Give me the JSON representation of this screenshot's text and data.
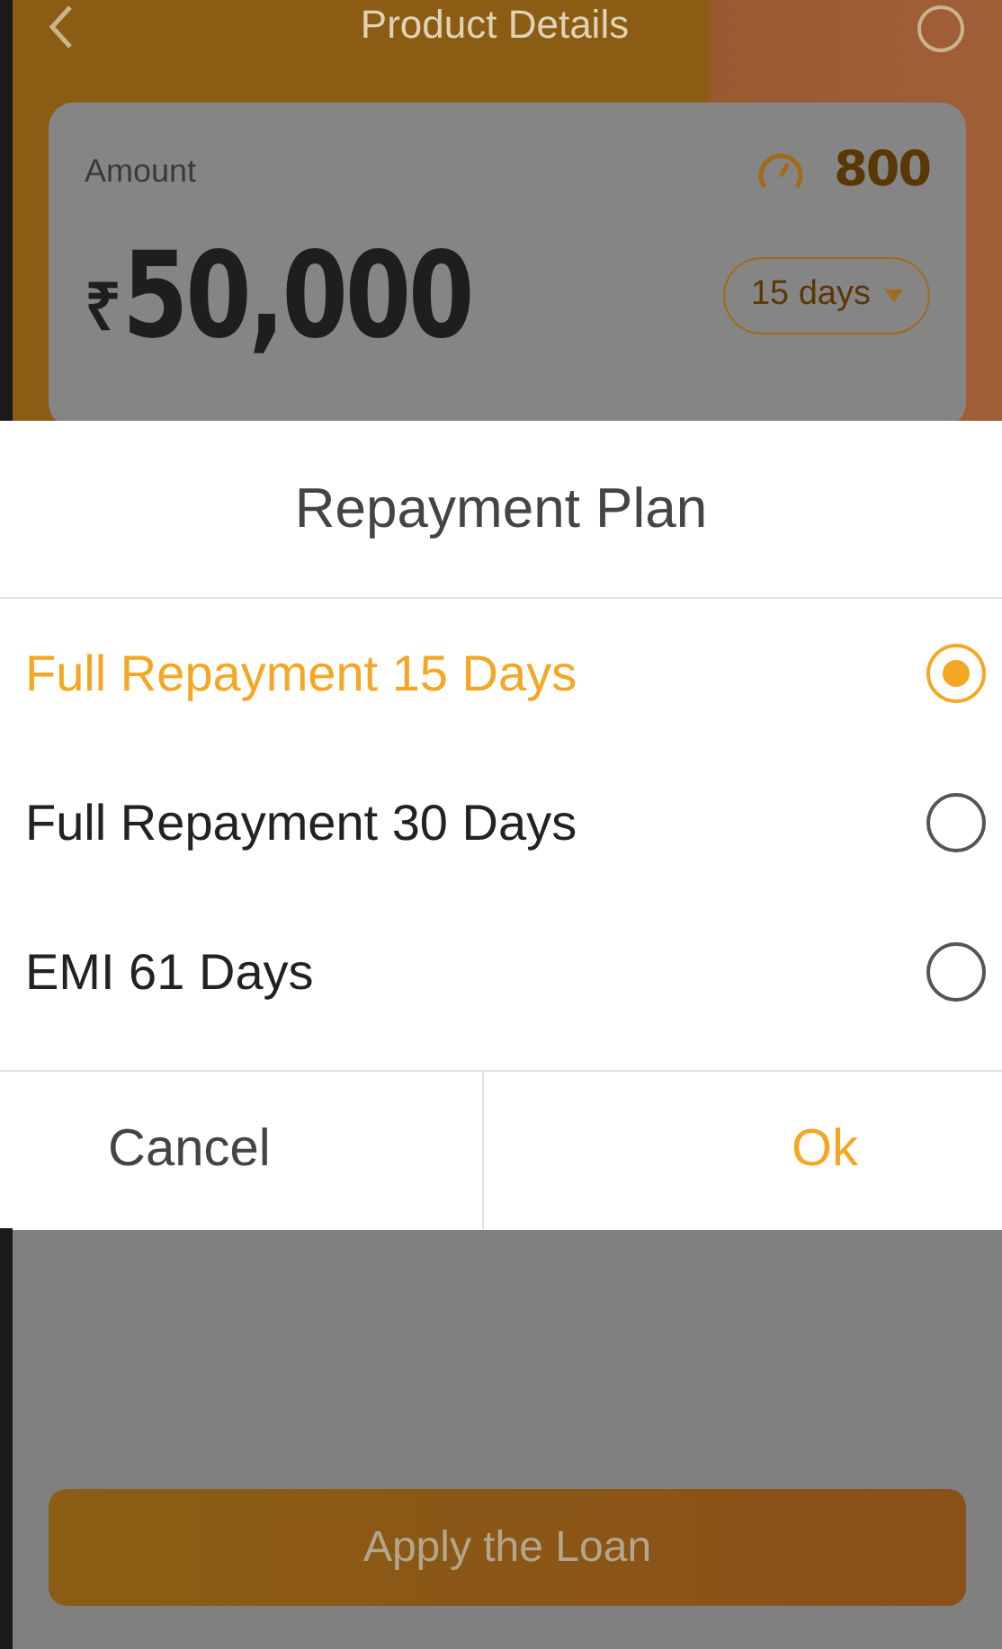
{
  "header": {
    "title": "Product Details"
  },
  "card": {
    "label": "Amount",
    "score": "800",
    "currency": "₹",
    "amount": "50,000",
    "term": "15 days"
  },
  "dialog": {
    "title": "Repayment Plan",
    "options": [
      {
        "label": "Full Repayment 15 Days",
        "selected": true
      },
      {
        "label": "Full Repayment 30 Days",
        "selected": false
      },
      {
        "label": "EMI 61 Days",
        "selected": false
      }
    ],
    "buttons": [
      {
        "label": "Cancel",
        "kind": "cancel"
      },
      {
        "label": "Ok",
        "kind": "confirm"
      }
    ]
  },
  "apply_button": "Apply the Loan"
}
